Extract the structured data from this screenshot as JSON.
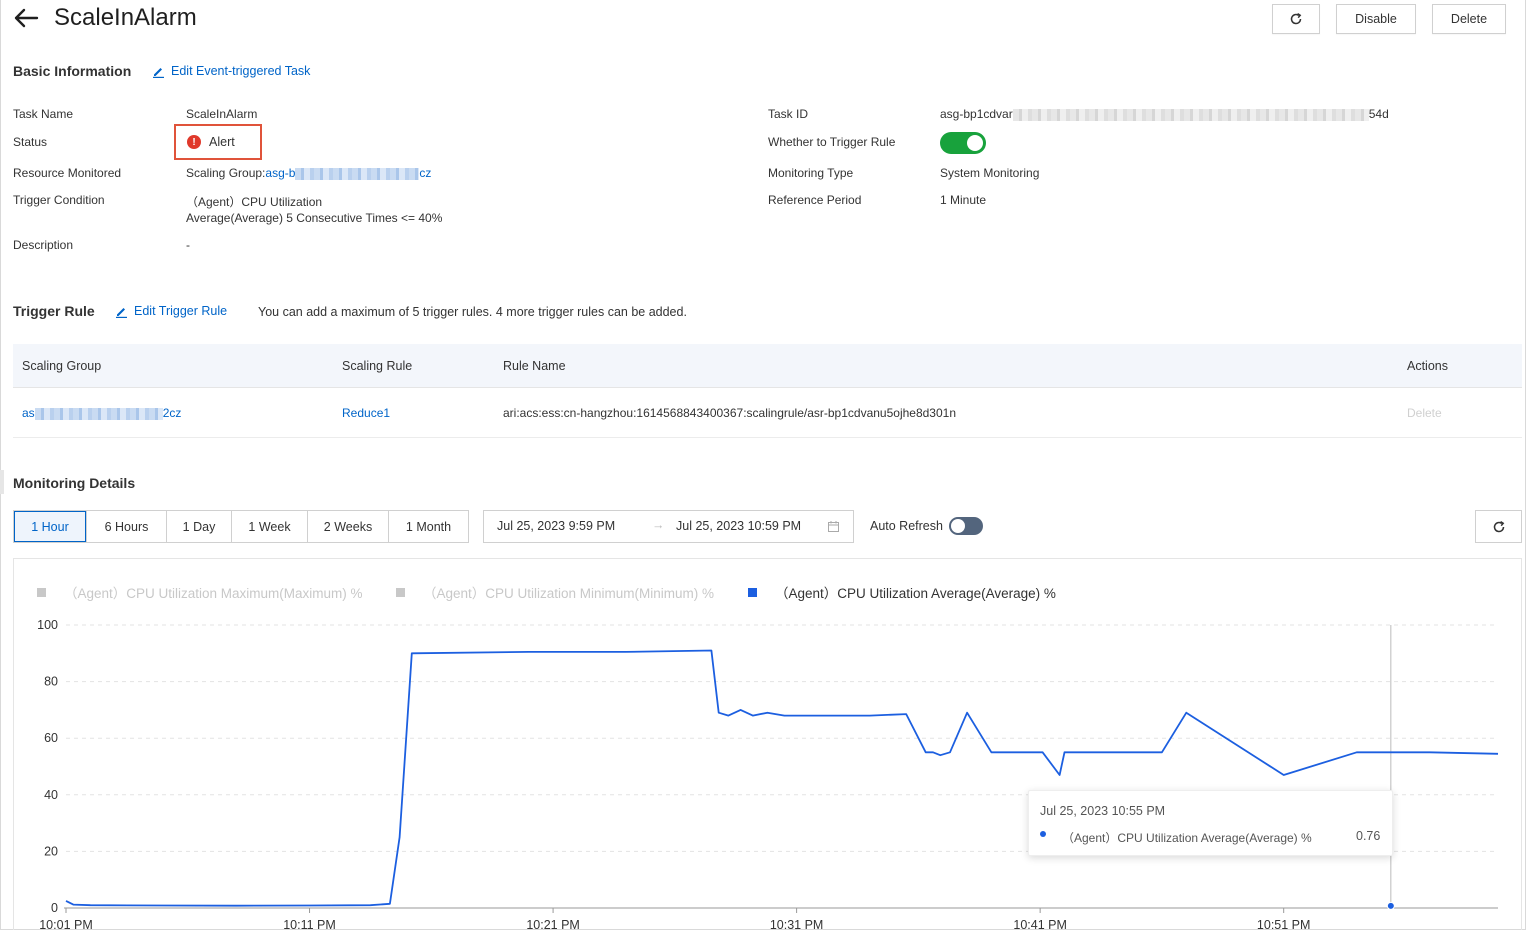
{
  "header": {
    "title": "ScaleInAlarm",
    "buttons": {
      "disable": "Disable",
      "delete": "Delete"
    }
  },
  "basic_info": {
    "section_title": "Basic Information",
    "edit_link": "Edit Event-triggered Task",
    "task_name_label": "Task Name",
    "task_name": "ScaleInAlarm",
    "status_label": "Status",
    "status": "Alert",
    "resource_label": "Resource Monitored",
    "resource_prefix": "Scaling Group:",
    "resource_link_start": "asg-b",
    "resource_link_end": "cz",
    "trigger_condition_label": "Trigger Condition",
    "trigger_condition_line1": "（Agent）CPU Utilization",
    "trigger_condition_line2": "Average(Average) 5 Consecutive Times <= 40%",
    "description_label": "Description",
    "description": "-",
    "task_id_label": "Task ID",
    "task_id_start": "asg-bp1cdvar",
    "task_id_end": "54d",
    "trigger_rule_label": "Whether to Trigger Rule",
    "trigger_rule_enabled": true,
    "monitoring_type_label": "Monitoring Type",
    "monitoring_type": "System Monitoring",
    "reference_period_label": "Reference Period",
    "reference_period": "1 Minute"
  },
  "trigger_rule": {
    "section_title": "Trigger Rule",
    "edit_link": "Edit Trigger Rule",
    "note": "You can add a maximum of 5 trigger rules. 4 more trigger rules can be added.",
    "columns": [
      "Scaling Group",
      "Scaling Rule",
      "Rule Name",
      "Actions"
    ],
    "row": {
      "scaling_group_start": "as",
      "scaling_group_end": "2cz",
      "scaling_rule": "Reduce1",
      "rule_name": "ari:acs:ess:cn-hangzhou:1614568843400367:scalingrule/asr-bp1cdvanu5ojhe8d301n",
      "action": "Delete"
    }
  },
  "monitoring": {
    "section_title": "Monitoring Details",
    "ranges": [
      "1 Hour",
      "6 Hours",
      "1 Day",
      "1 Week",
      "2 Weeks",
      "1 Month"
    ],
    "active_range": "1 Hour",
    "date_start": "Jul 25, 2023 9:59 PM",
    "date_end": "Jul 25, 2023 10:59 PM",
    "date_separator": "→",
    "auto_refresh_label": "Auto Refresh",
    "auto_refresh_enabled": false
  },
  "chart_data": {
    "type": "line",
    "legend": [
      {
        "name": "（Agent）CPU Utilization Maximum(Maximum) %",
        "color": "#c8c8c8",
        "active": false
      },
      {
        "name": "（Agent）CPU Utilization Minimum(Minimum) %",
        "color": "#c8c8c8",
        "active": false
      },
      {
        "name": "（Agent）CPU Utilization Average(Average) %",
        "color": "#1c5fe0",
        "active": true
      }
    ],
    "y_ticks": [
      "100",
      "80",
      "60",
      "40",
      "20",
      "0"
    ],
    "ylim": [
      0,
      100
    ],
    "x_ticks": [
      "10:01 PM",
      "10:11 PM",
      "10:21 PM",
      "10:31 PM",
      "10:41 PM",
      "10:51 PM"
    ],
    "x_tick_minutes": [
      1,
      11,
      21,
      31,
      41,
      51
    ],
    "xlim_minutes": [
      1,
      59.8
    ],
    "series": [
      {
        "name": "（Agent）CPU Utilization Average(Average) %",
        "color": "#1c5fe0",
        "x_minutes": [
          1,
          1.3,
          2,
          5,
          8,
          11,
          13.5,
          14.3,
          14.7,
          15.2,
          20,
          24,
          27.5,
          27.8,
          28.2,
          28.7,
          29.2,
          29.8,
          30.5,
          32,
          34,
          35.5,
          36.3,
          36.6,
          36.9,
          37.3,
          38,
          39,
          40.3,
          41.1,
          41.8,
          42,
          42.4,
          43,
          46,
          47,
          51,
          54,
          55,
          57,
          59.8
        ],
        "values": [
          2.5,
          1.2,
          1.0,
          0.9,
          0.8,
          0.9,
          1.0,
          1.5,
          25,
          90,
          90.5,
          90.5,
          91.0,
          69,
          68,
          70,
          68,
          69,
          68,
          68,
          68,
          68.5,
          55,
          55,
          54,
          55,
          69,
          55,
          55,
          55,
          47,
          55,
          55,
          55,
          55,
          69,
          47,
          55,
          55,
          55,
          54.5
        ]
      }
    ],
    "tooltip": {
      "time": "Jul 25, 2023 10:55 PM",
      "series": "（Agent）CPU Utilization Average(Average) %",
      "value": "0.76"
    }
  }
}
